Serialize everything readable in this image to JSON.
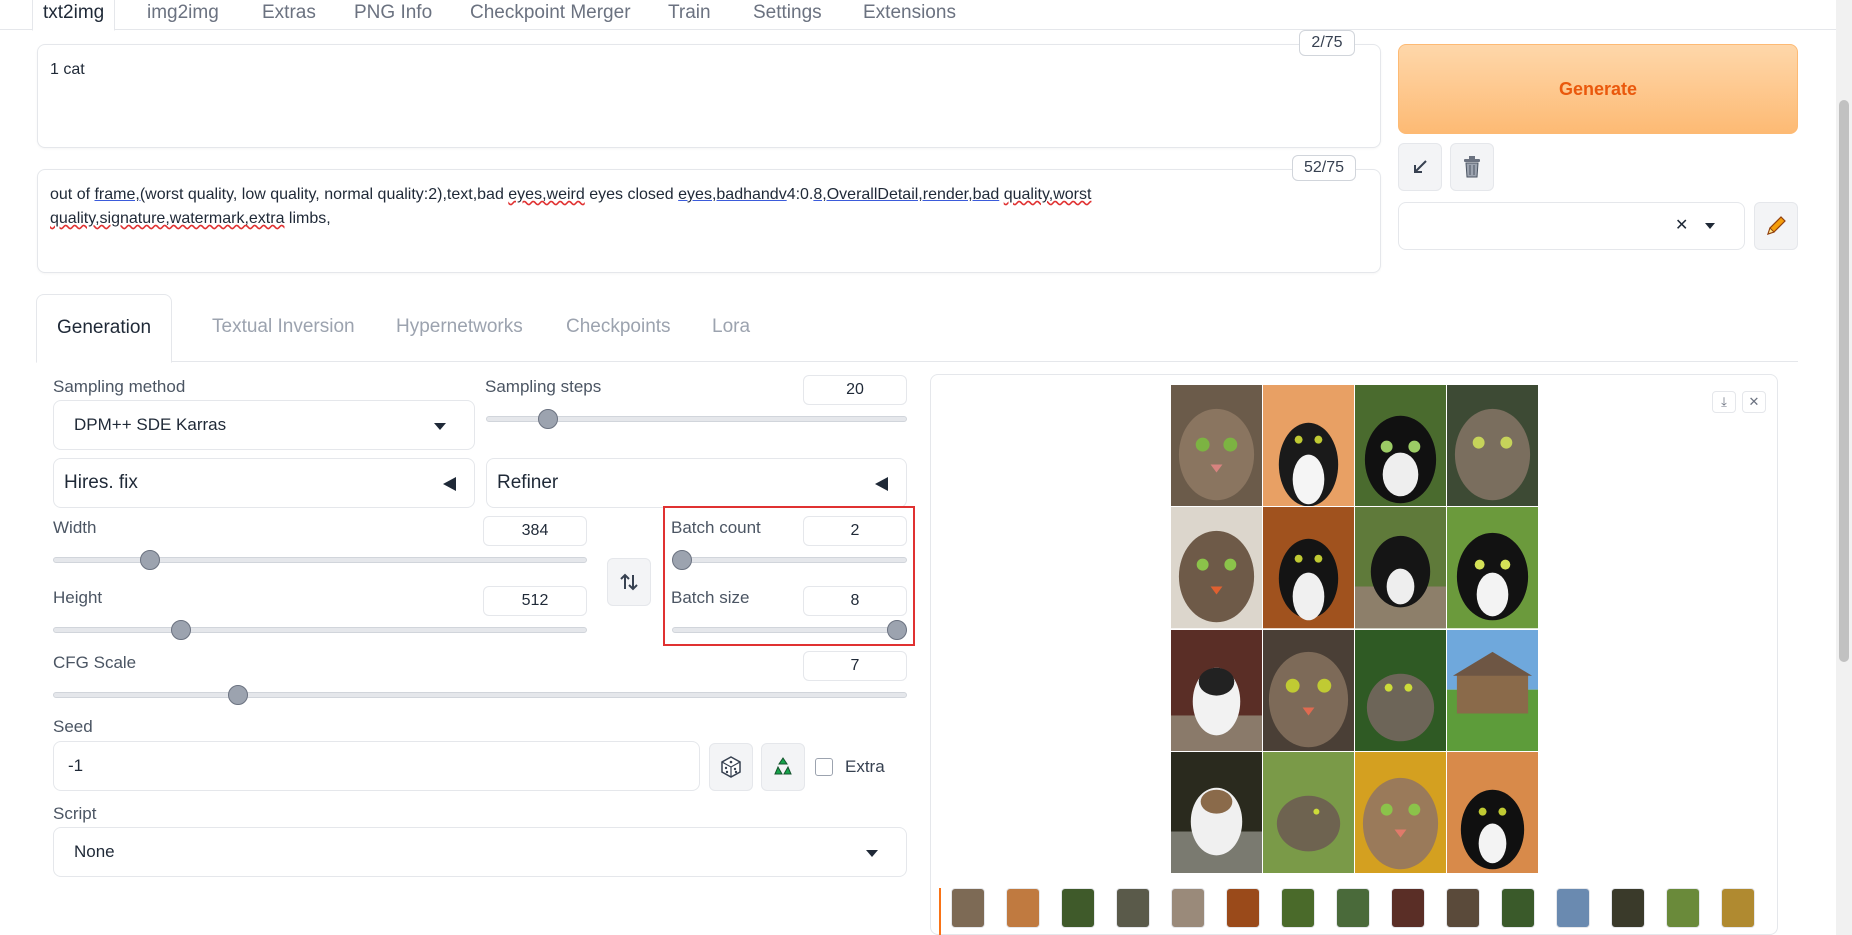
{
  "top_tabs": [
    {
      "label": "txt2img",
      "active": true
    },
    {
      "label": "img2img"
    },
    {
      "label": "Extras"
    },
    {
      "label": "PNG Info"
    },
    {
      "label": "Checkpoint Merger"
    },
    {
      "label": "Train"
    },
    {
      "label": "Settings"
    },
    {
      "label": "Extensions"
    }
  ],
  "prompt": {
    "positive_text": "1 cat",
    "positive_count": "2/75",
    "negative_count": "52/75",
    "negative_segments": [
      {
        "text": "out of ",
        "style": ""
      },
      {
        "text": "frame,(",
        "style": "ul-blue"
      },
      {
        "text": "worst quality, low quality, normal quality:2),text,bad ",
        "style": ""
      },
      {
        "text": "eyes,weird",
        "style": "ul-red"
      },
      {
        "text": " eyes closed ",
        "style": ""
      },
      {
        "text": "eyes,badhandv",
        "style": "ul-blue"
      },
      {
        "text": "4:0.",
        "style": ""
      },
      {
        "text": "8,OverallDetail,render,bad",
        "style": "ul-blue"
      },
      {
        "text": " ",
        "style": ""
      },
      {
        "text": "quality,worst",
        "style": "ul-red"
      }
    ],
    "negative_line2_segments": [
      {
        "text": "quality,signature,watermark,extra",
        "style": "ul-red"
      },
      {
        "text": " limbs,",
        "style": ""
      }
    ]
  },
  "actions": {
    "generate_label": "Generate",
    "arrow_icon": "arrow-down-left-icon",
    "trash_icon": "trash-icon",
    "edit_icon": "pencil-icon",
    "clear_glyph": "✕"
  },
  "sub_tabs": [
    {
      "label": "Generation",
      "active": true
    },
    {
      "label": "Textual Inversion"
    },
    {
      "label": "Hypernetworks"
    },
    {
      "label": "Checkpoints"
    },
    {
      "label": "Lora"
    }
  ],
  "generation": {
    "sampling_method_label": "Sampling method",
    "sampling_method_value": "DPM++ SDE Karras",
    "sampling_steps_label": "Sampling steps",
    "sampling_steps_value": "20",
    "sampling_steps_fraction": 0.13,
    "hires_label": "Hires. fix",
    "refiner_label": "Refiner",
    "width_label": "Width",
    "width_value": "384",
    "width_fraction": 0.17,
    "height_label": "Height",
    "height_value": "512",
    "height_fraction": 0.23,
    "batch_count_label": "Batch count",
    "batch_count_value": "2",
    "batch_count_fraction": 0.0,
    "batch_size_label": "Batch size",
    "batch_size_value": "8",
    "batch_size_fraction": 1.0,
    "cfg_label": "CFG Scale",
    "cfg_value": "7",
    "cfg_fraction": 0.21,
    "seed_label": "Seed",
    "seed_value": "-1",
    "extra_label": "Extra",
    "script_label": "Script",
    "script_value": "None",
    "swap_icon": "swap-dimensions-icon",
    "dice_icon": "dice-icon",
    "recycle_icon": "recycle-icon"
  },
  "gallery": {
    "download_icon": "download-icon",
    "close_icon": "close-icon",
    "colors": {
      "accent": "#f97316",
      "selection_box": "#e03131"
    }
  }
}
